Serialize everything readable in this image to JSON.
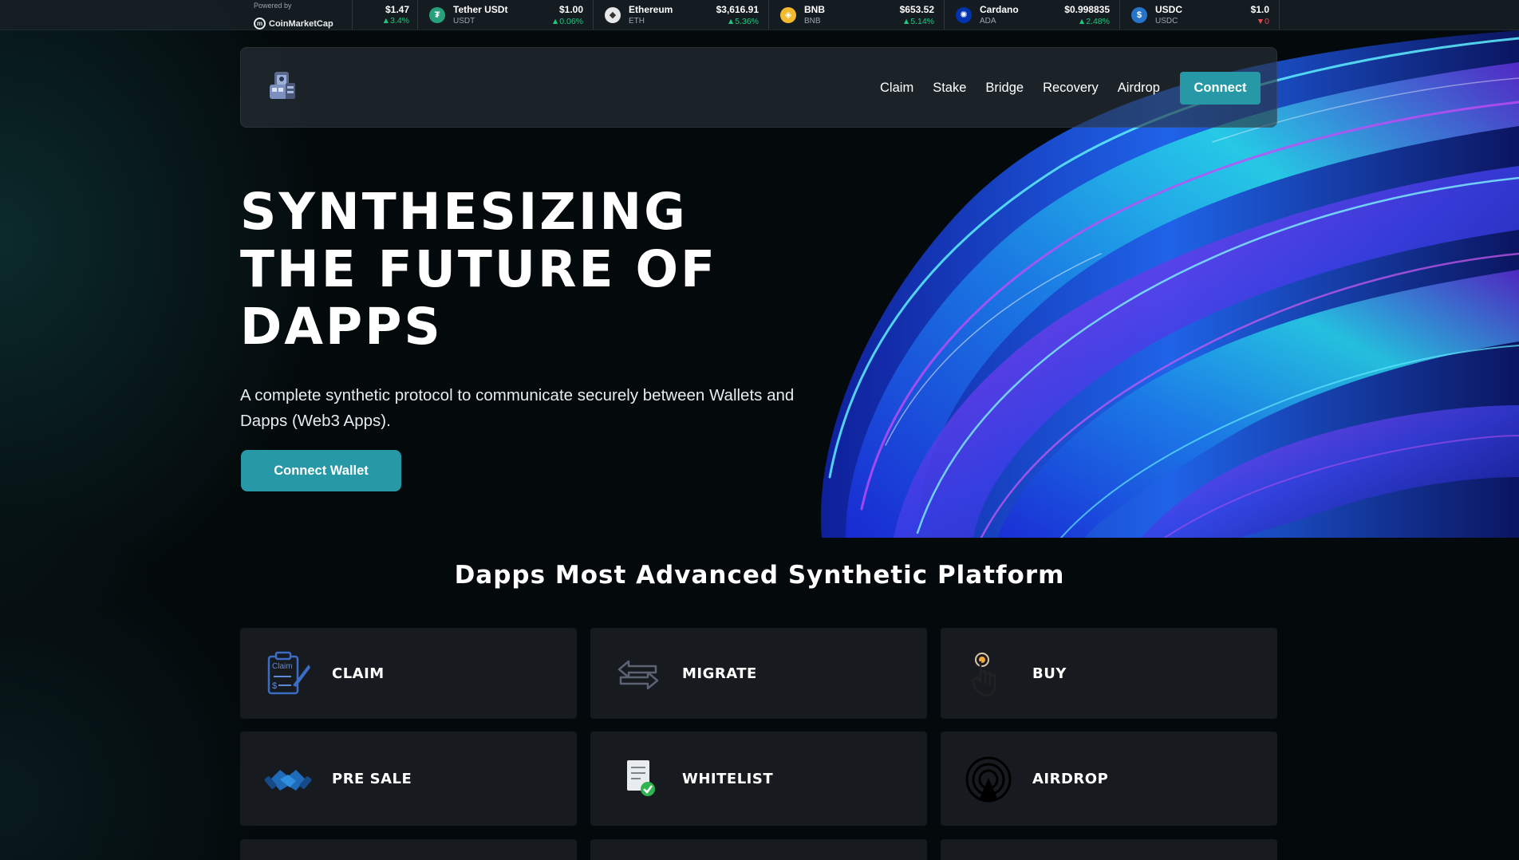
{
  "ticker": {
    "powered_by": "Powered by",
    "provider": "CoinMarketCap",
    "first": {
      "price": "$1.47",
      "change": "▲3.4%"
    },
    "coins": [
      {
        "name": "Tether USDt",
        "symbol": "USDT",
        "price": "$1.00",
        "change": "▲0.06%",
        "direction": "up",
        "icon": "tether-icon",
        "color": "#26a17b",
        "glyph": "₮"
      },
      {
        "name": "Ethereum",
        "symbol": "ETH",
        "price": "$3,616.91",
        "change": "▲5.36%",
        "direction": "up",
        "icon": "ethereum-icon",
        "color": "#e6e8ea",
        "glyph": "◆"
      },
      {
        "name": "BNB",
        "symbol": "BNB",
        "price": "$653.52",
        "change": "▲5.14%",
        "direction": "up",
        "icon": "bnb-icon",
        "color": "#f3ba2f",
        "glyph": "◈"
      },
      {
        "name": "Cardano",
        "symbol": "ADA",
        "price": "$0.998835",
        "change": "▲2.48%",
        "direction": "up",
        "icon": "cardano-icon",
        "color": "#0033ad",
        "glyph": "✺"
      },
      {
        "name": "USDC",
        "symbol": "USDC",
        "price": "$1.0",
        "change": "▼0",
        "direction": "down",
        "icon": "usdc-icon",
        "color": "#2775ca",
        "glyph": "$"
      }
    ]
  },
  "nav": {
    "links": [
      "Claim",
      "Stake",
      "Bridge",
      "Recovery",
      "Airdrop"
    ],
    "connect_label": "Connect"
  },
  "hero": {
    "title_line1": "SYNTHESIZING",
    "title_line2": "THE FUTURE OF",
    "title_line3": "DAPPS",
    "subtitle": "A complete synthetic protocol to communicate securely between Wallets and Dapps (Web3 Apps).",
    "cta_label": "Connect Wallet"
  },
  "features": {
    "title": "Dapps Most Advanced Synthetic Platform",
    "claim_icon_text": "Claim",
    "claim_icon_currency": "$",
    "cards": [
      {
        "label": "CLAIM",
        "icon": "claim-document-icon"
      },
      {
        "label": "MIGRATE",
        "icon": "migrate-arrows-icon"
      },
      {
        "label": "BUY",
        "icon": "tap-hand-icon"
      },
      {
        "label": "PRE SALE",
        "icon": "handshake-icon"
      },
      {
        "label": "WHITELIST",
        "icon": "checklist-icon"
      },
      {
        "label": "AIRDROP",
        "icon": "airdrop-signal-icon"
      }
    ]
  },
  "colors": {
    "accent": "#2798a5",
    "up": "#1fc77e",
    "down": "#e8484c",
    "background": "#04090b",
    "card": "#171b1f"
  }
}
